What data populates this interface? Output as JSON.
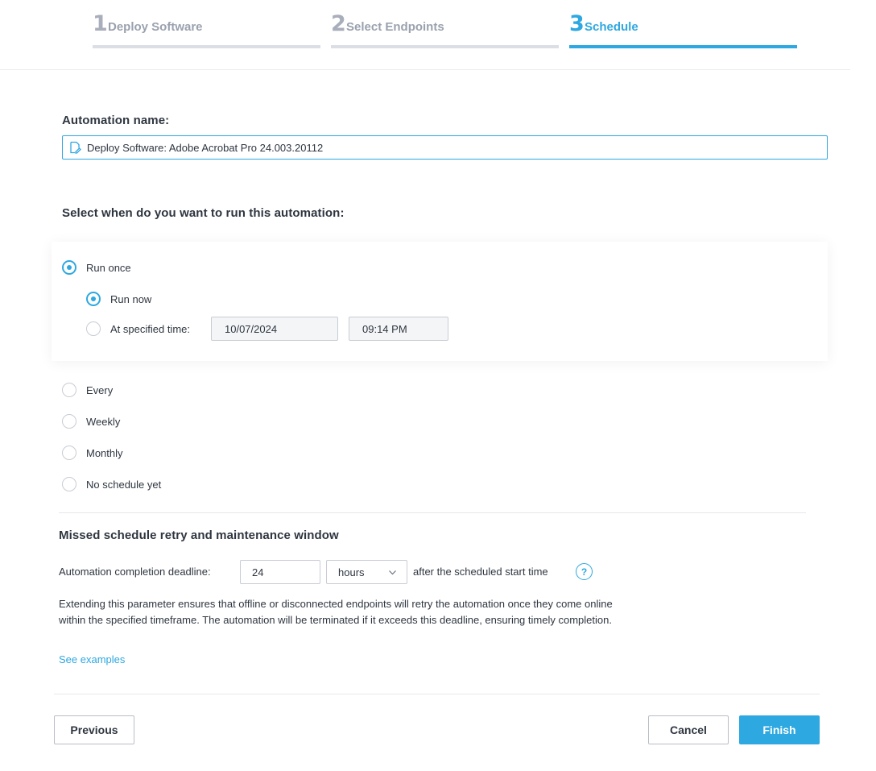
{
  "stepper": {
    "steps": [
      {
        "number": "1",
        "label": "Deploy Software",
        "active": false
      },
      {
        "number": "2",
        "label": "Select Endpoints",
        "active": false
      },
      {
        "number": "3",
        "label": "Schedule",
        "active": true
      }
    ]
  },
  "automation": {
    "name_label": "Automation name:",
    "name_value": "Deploy Software: Adobe Acrobat Pro 24.003.20112",
    "icon": "edit-icon"
  },
  "schedule": {
    "question": "Select when do you want to run this automation:",
    "options": [
      {
        "label": "Run once",
        "selected": true
      },
      {
        "label": "Every",
        "selected": false
      },
      {
        "label": "Weekly",
        "selected": false
      },
      {
        "label": "Monthly",
        "selected": false
      },
      {
        "label": "No schedule yet",
        "selected": false
      }
    ],
    "run_once": {
      "run_now_label": "Run now",
      "run_now_selected": true,
      "specified_label": "At specified time:",
      "specified_selected": false,
      "date": "10/07/2024",
      "time": "09:14 PM"
    }
  },
  "retry": {
    "heading": "Missed schedule retry and maintenance window",
    "deadline_label": "Automation completion deadline:",
    "deadline_value": "24",
    "unit": "hours",
    "after_text": "after the scheduled start time",
    "help_glyph": "?",
    "description": "Extending this parameter ensures that offline or disconnected endpoints will retry the automation once they come online within the specified timeframe. The automation will be terminated if it exceeds this deadline, ensuring timely completion.",
    "examples_link": "See examples"
  },
  "footer": {
    "previous": "Previous",
    "cancel": "Cancel",
    "finish": "Finish"
  },
  "colors": {
    "accent": "#2ea8e0",
    "text": "#2f3640",
    "muted": "#9aa1ae"
  }
}
